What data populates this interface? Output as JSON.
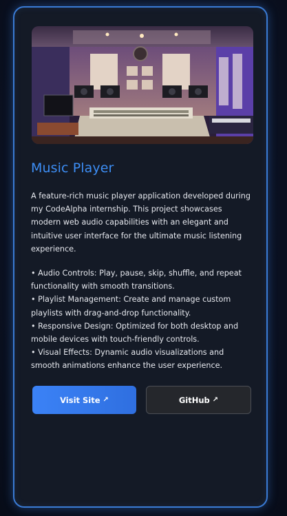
{
  "project": {
    "title": "Music Player",
    "description": "A feature-rich music player application developed during my CodeAlpha internship. This project showcases modern web audio capabilities with an elegant and intuitive user interface for the ultimate music listening experience.",
    "features": [
      "• Audio Controls: Play, pause, skip, shuffle, and repeat functionality with smooth transitions.",
      "• Playlist Management: Create and manage custom playlists with drag-and-drop functionality.",
      "• Responsive Design: Optimized for both desktop and mobile devices with touch-friendly controls.",
      "• Visual Effects: Dynamic audio visualizations and smooth animations enhance the user experience."
    ],
    "buttons": {
      "visit_label": "Visit Site",
      "github_label": "GitHub",
      "arrow": "↗"
    }
  },
  "colors": {
    "accent": "#3d8ef5",
    "card_border": "#3a7bd5",
    "primary_button": "#3b82f6",
    "secondary_button": "#25272c"
  },
  "icons": {
    "external_link": "external-link-icon"
  }
}
